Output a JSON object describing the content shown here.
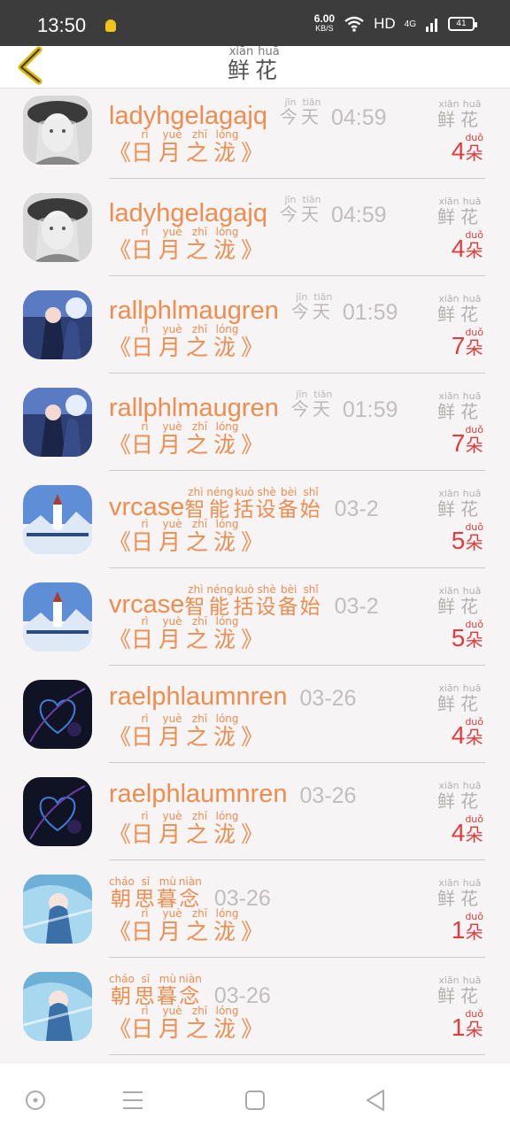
{
  "status_bar": {
    "time": "13:50",
    "net_speed": "6.00",
    "net_unit": "KB/S",
    "hd": "HD",
    "signal": "4G",
    "battery": "41"
  },
  "header": {
    "title_chars": [
      {
        "char": "鲜",
        "pinyin": "xiān"
      },
      {
        "char": "花",
        "pinyin": "huā"
      }
    ]
  },
  "flower_label": [
    {
      "char": "鲜",
      "pinyin": "xiān"
    },
    {
      "char": "花",
      "pinyin": "huā"
    }
  ],
  "unit": {
    "char": "朵",
    "pinyin": "duǒ"
  },
  "gift": {
    "open": "《",
    "close": "》",
    "chars": [
      {
        "char": "日",
        "pinyin": "rì"
      },
      {
        "char": "月",
        "pinyin": "yuè"
      },
      {
        "char": "之",
        "pinyin": "zhī"
      },
      {
        "char": "泷",
        "pinyin": "lóng"
      }
    ]
  },
  "today": [
    {
      "char": "今",
      "pinyin": "jīn"
    },
    {
      "char": "天",
      "pinyin": "tiān"
    }
  ],
  "rows": [
    {
      "name": "ladyhgelagajq",
      "name_chars": [],
      "today": true,
      "time": "04:59",
      "count": "4",
      "avatar": "girl-hat"
    },
    {
      "name": "ladyhgelagajq",
      "name_chars": [],
      "today": true,
      "time": "04:59",
      "count": "4",
      "avatar": "girl-hat"
    },
    {
      "name": "rallphlmaugren",
      "name_chars": [],
      "today": true,
      "time": "01:59",
      "count": "7",
      "avatar": "anime-couple"
    },
    {
      "name": "rallphlmaugren",
      "name_chars": [],
      "today": true,
      "time": "01:59",
      "count": "7",
      "avatar": "anime-couple"
    },
    {
      "name": "vrcase",
      "name_chars": [
        {
          "char": "智",
          "pinyin": "zhì"
        },
        {
          "char": "能",
          "pinyin": "néng"
        },
        {
          "char": "括",
          "pinyin": "kuò"
        },
        {
          "char": "设",
          "pinyin": "shè"
        },
        {
          "char": "备",
          "pinyin": "bèi"
        },
        {
          "char": "始",
          "pinyin": "shǐ"
        }
      ],
      "today": false,
      "time": "03-2",
      "count": "5",
      "avatar": "snow-church"
    },
    {
      "name": "vrcase",
      "name_chars": [
        {
          "char": "智",
          "pinyin": "zhì"
        },
        {
          "char": "能",
          "pinyin": "néng"
        },
        {
          "char": "括",
          "pinyin": "kuò"
        },
        {
          "char": "设",
          "pinyin": "shè"
        },
        {
          "char": "备",
          "pinyin": "bèi"
        },
        {
          "char": "始",
          "pinyin": "shǐ"
        }
      ],
      "today": false,
      "time": "03-2",
      "count": "5",
      "avatar": "snow-church"
    },
    {
      "name": "raelphlaumnren",
      "name_chars": [],
      "today": false,
      "time": "03-26",
      "count": "4",
      "avatar": "dark-heart"
    },
    {
      "name": "raelphlaumnren",
      "name_chars": [],
      "today": false,
      "time": "03-26",
      "count": "4",
      "avatar": "dark-heart"
    },
    {
      "name": "",
      "name_chars": [
        {
          "char": "朝",
          "pinyin": "cháo"
        },
        {
          "char": "思",
          "pinyin": "sī"
        },
        {
          "char": "暮",
          "pinyin": "mù"
        },
        {
          "char": "念",
          "pinyin": "niàn"
        }
      ],
      "today": false,
      "time": "03-26",
      "count": "1",
      "avatar": "anime-blue"
    },
    {
      "name": "",
      "name_chars": [
        {
          "char": "朝",
          "pinyin": "cháo"
        },
        {
          "char": "思",
          "pinyin": "sī"
        },
        {
          "char": "暮",
          "pinyin": "mù"
        },
        {
          "char": "念",
          "pinyin": "niàn"
        }
      ],
      "today": false,
      "time": "03-26",
      "count": "1",
      "avatar": "anime-blue"
    }
  ],
  "colors": {
    "accent": "#ef8c4e",
    "count": "#e13c3c",
    "muted": "#bdb7b7"
  }
}
